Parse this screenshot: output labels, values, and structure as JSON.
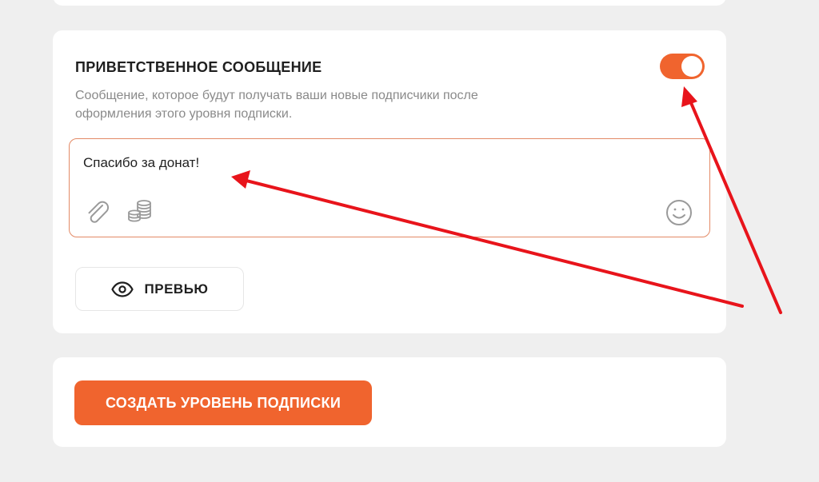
{
  "greeting": {
    "title": "ПРИВЕТСТВЕННОЕ СООБЩЕНИЕ",
    "description": "Сообщение, которое будут получать ваши новые подписчики после оформления этого уровня подписки.",
    "toggle_enabled": true,
    "message": "Спасибо за донат!",
    "preview_label": "ПРЕВЬЮ"
  },
  "actions": {
    "create_label": "СОЗДАТЬ УРОВЕНЬ ПОДПИСКИ"
  },
  "icons": {
    "attach": "paperclip-icon",
    "coins": "coins-icon",
    "emoji": "smile-icon",
    "preview": "eye-icon"
  },
  "colors": {
    "accent": "#f0642e",
    "annotation_arrow": "#e8141b",
    "background": "#efefef",
    "card": "#ffffff"
  }
}
